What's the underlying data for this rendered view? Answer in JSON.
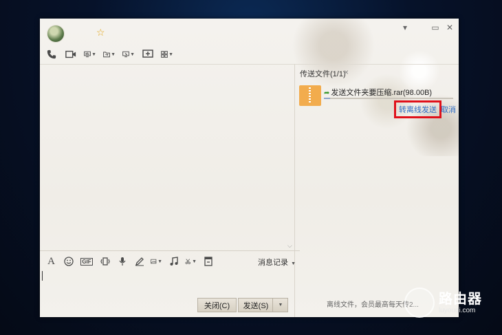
{
  "window": {
    "title_controls": [
      "▾",
      "▭",
      "✕"
    ]
  },
  "titlebar": {
    "star_icon": "star-icon"
  },
  "toolbar": {
    "items": [
      {
        "name": "phone-icon",
        "caret": false
      },
      {
        "name": "video-icon",
        "caret": false
      },
      {
        "name": "screen-share-icon",
        "caret": true
      },
      {
        "name": "file-transfer-icon",
        "caret": true
      },
      {
        "name": "remote-desktop-icon",
        "caret": true
      },
      {
        "name": "new-chat-icon",
        "caret": false
      },
      {
        "name": "apps-icon",
        "caret": true
      }
    ]
  },
  "input_toolbar": {
    "items": [
      "font-icon",
      "emoji-icon",
      "gif-icon",
      "shake-icon",
      "voice-icon",
      "draw-icon",
      "image-icon",
      "music-icon",
      "scissors-icon",
      "recall-icon"
    ],
    "gif_label": "GIF",
    "history_label": "消息记录"
  },
  "buttons": {
    "close_label": "关闭(C)",
    "send_label": "发送(S)"
  },
  "transfer_panel": {
    "tab_label": "传送文件(1/1)",
    "file_name": "发送文件夹要压缩.rar(98.00B)",
    "progress": 0.05,
    "offline_send_label": "转离线发送",
    "cancel_label": "取消",
    "footnote": "离线文件，会员最高每天传2..."
  },
  "watermark": {
    "cn": "路由器",
    "en": "luyouqi.com"
  }
}
